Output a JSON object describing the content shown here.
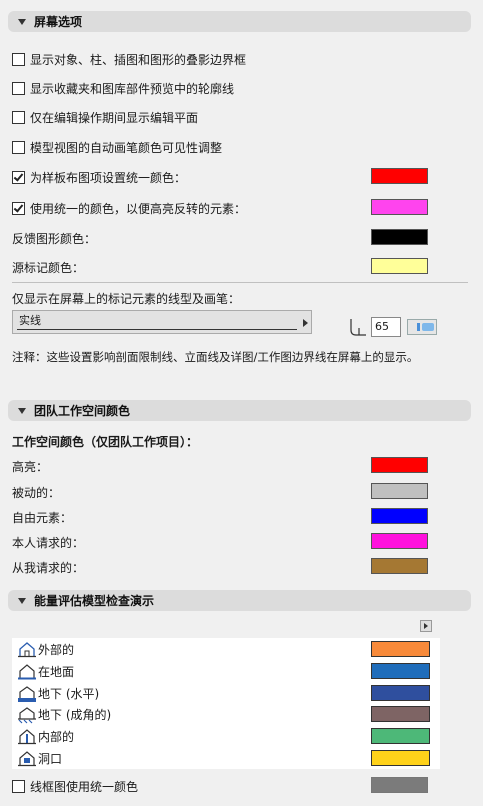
{
  "screen_options": {
    "header": "屏幕选项",
    "checkbox_items": [
      {
        "label": "显示对象、柱、插图和图形的叠影边界框",
        "checked": false
      },
      {
        "label": "显示收藏夹和图库部件预览中的轮廓线",
        "checked": false
      },
      {
        "label": "仅在编辑操作期间显示编辑平面",
        "checked": false
      },
      {
        "label": "模型视图的自动画笔颜色可见性调整",
        "checked": false
      },
      {
        "label": "为样板布图项设置统一颜色：",
        "checked": true,
        "color": "#ff0000"
      },
      {
        "label": "使用统一的颜色，以便高亮反转的元素：",
        "checked": true,
        "color": "#ff44ee"
      }
    ],
    "feedback_label": "反馈图形颜色：",
    "feedback_color": "#000000",
    "source_label": "源标记颜色：",
    "source_color": "#ffff99",
    "linetype_caption": "仅显示在屏幕上的标记元素的线型及画笔：",
    "linetype_value": "实线",
    "pen_value": "65",
    "note": "注释：这些设置影响剖面限制线、立面线及详图/工作图边界线在屏幕上的显示。"
  },
  "teamwork": {
    "header": "团队工作空间颜色",
    "subheader": "工作空间颜色（仅团队工作项目）：",
    "items": [
      {
        "label": "高亮：",
        "color": "#ff0000"
      },
      {
        "label": "被动的：",
        "color": "#c0c0c0"
      },
      {
        "label": "自由元素：",
        "color": "#0000ff"
      },
      {
        "label": "本人请求的：",
        "color": "#ff11dd"
      },
      {
        "label": "从我请求的：",
        "color": "#a57833"
      }
    ]
  },
  "energy": {
    "header": "能量评估模型检查演示",
    "items": [
      {
        "label": "外部的",
        "icon": "exterior-house-icon",
        "color": "#f88a3a"
      },
      {
        "label": "在地面",
        "icon": "on-grade-house-icon",
        "color": "#1f6dbb"
      },
      {
        "label": "地下 (水平)",
        "icon": "underground-horizontal-icon",
        "color": "#2f4f9e"
      },
      {
        "label": "地下 (成角的)",
        "icon": "underground-angled-icon",
        "color": "#7e6464"
      },
      {
        "label": "内部的",
        "icon": "interior-house-icon",
        "color": "#4db878"
      },
      {
        "label": "洞口",
        "icon": "opening-house-icon",
        "color": "#ffd21a"
      }
    ],
    "uniform_label": "线框图使用统一颜色",
    "uniform_checked": false,
    "uniform_color": "#7b7b7b"
  }
}
